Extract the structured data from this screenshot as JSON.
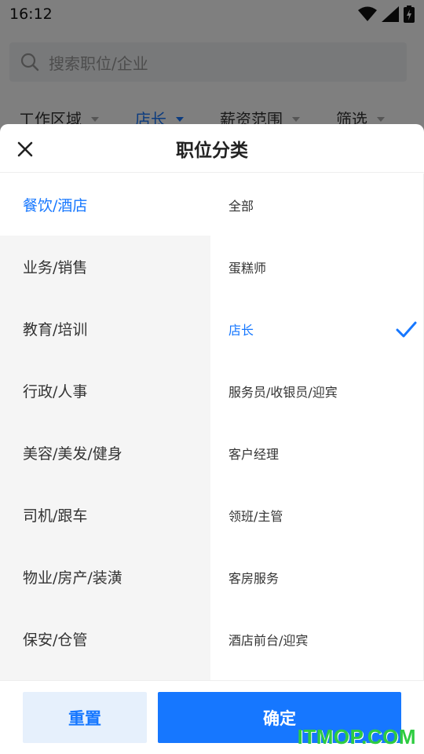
{
  "status_bar": {
    "time": "16:12"
  },
  "search": {
    "placeholder": "搜索职位/企业"
  },
  "filters": [
    {
      "label": "工作区域",
      "active": false
    },
    {
      "label": "店长",
      "active": true
    },
    {
      "label": "薪资范围",
      "active": false
    },
    {
      "label": "筛选",
      "active": false
    }
  ],
  "sheet": {
    "title": "职位分类",
    "categories": [
      {
        "label": "餐饮/酒店",
        "active": true
      },
      {
        "label": "业务/销售"
      },
      {
        "label": "教育/培训"
      },
      {
        "label": "行政/人事"
      },
      {
        "label": "美容/美发/健身"
      },
      {
        "label": "司机/跟车"
      },
      {
        "label": "物业/房产/装潢"
      },
      {
        "label": "保安/仓管"
      }
    ],
    "positions": [
      {
        "label": "全部"
      },
      {
        "label": "蛋糕师"
      },
      {
        "label": "店长",
        "selected": true
      },
      {
        "label": "服务员/收银员/迎宾"
      },
      {
        "label": "客户经理"
      },
      {
        "label": "领班/主管"
      },
      {
        "label": "客房服务"
      },
      {
        "label": "酒店前台/迎宾"
      }
    ],
    "reset_label": "重置",
    "confirm_label": "确定"
  },
  "watermark": "ITMOP.COM",
  "colors": {
    "accent": "#1677ff",
    "reset_bg": "#e6f0fc",
    "left_bg": "#f5f5f5",
    "watermark": "#2ecc40"
  },
  "icons": [
    "wifi-icon",
    "signal-icon",
    "battery-icon",
    "search-icon",
    "close-icon",
    "checkmark-icon",
    "caret-down-icon"
  ]
}
